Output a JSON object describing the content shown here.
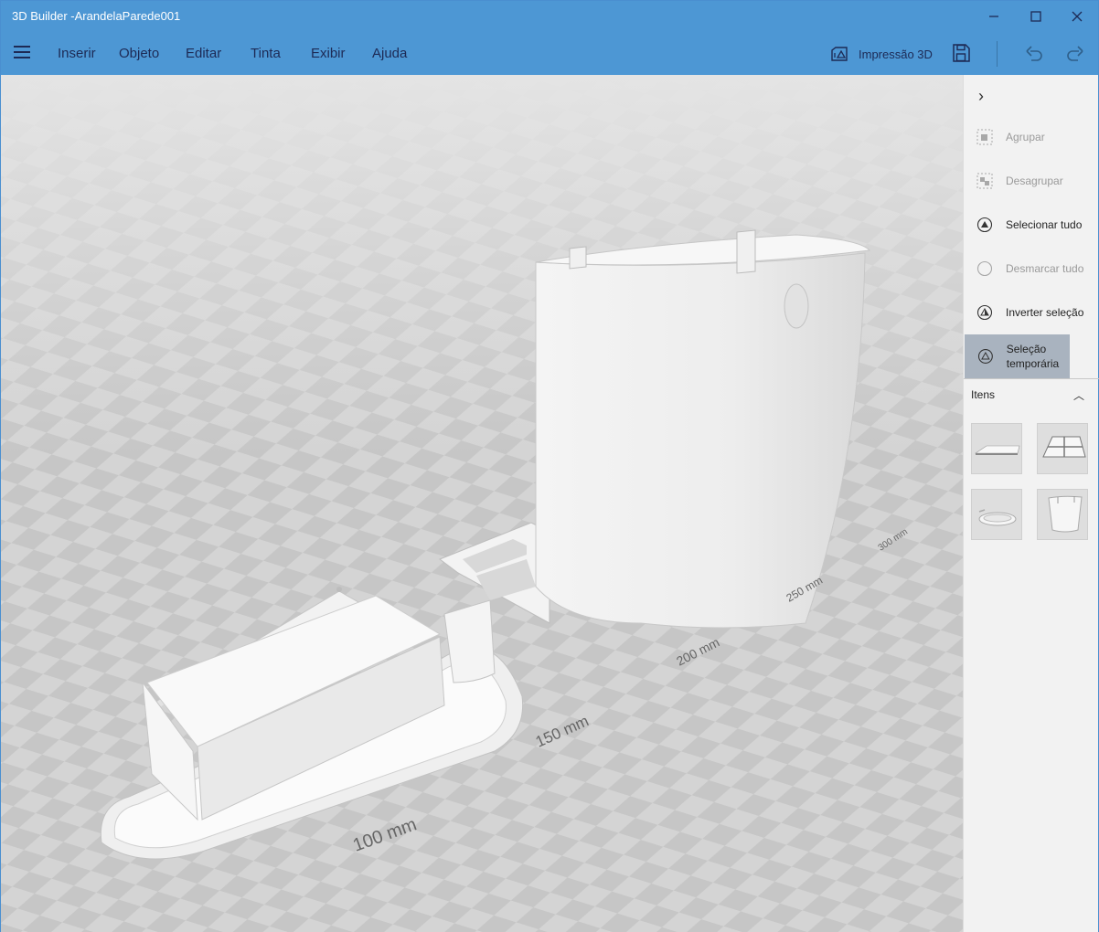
{
  "window": {
    "title": "3D Builder -ArandelaParede001",
    "controls": {
      "minimize": "minimize-icon",
      "maximize": "maximize-icon",
      "close": "close-icon"
    },
    "accent": "#4d97d4"
  },
  "menu": {
    "items": [
      {
        "label": "Inserir"
      },
      {
        "label": "Objeto"
      },
      {
        "label": "Editar"
      },
      {
        "label": "Tinta"
      },
      {
        "label": "Exibir"
      },
      {
        "label": "Ajuda"
      }
    ],
    "print3d_label": "Impressão 3D",
    "icons": [
      "hamburger-icon",
      "print3d-icon",
      "save-icon",
      "undo-icon",
      "redo-icon"
    ]
  },
  "viewport": {
    "ruler_labels": [
      "100 mm",
      "150 mm",
      "200 mm",
      "250 mm",
      "300 mm"
    ]
  },
  "panel": {
    "commands": [
      {
        "label": "Agrupar",
        "state": "disabled"
      },
      {
        "label": "Desagrupar",
        "state": "disabled"
      },
      {
        "label": "Selecionar tudo",
        "state": "enabled"
      },
      {
        "label": "Desmarcar tudo",
        "state": "disabled"
      },
      {
        "label": "Inverter seleção",
        "state": "enabled"
      },
      {
        "label": "Seleção temporária",
        "state": "active"
      }
    ],
    "items_title": "Itens",
    "items": [
      "plate-thumbnail",
      "frame-thumbnail",
      "ring-thumbnail",
      "cup-thumbnail"
    ]
  }
}
